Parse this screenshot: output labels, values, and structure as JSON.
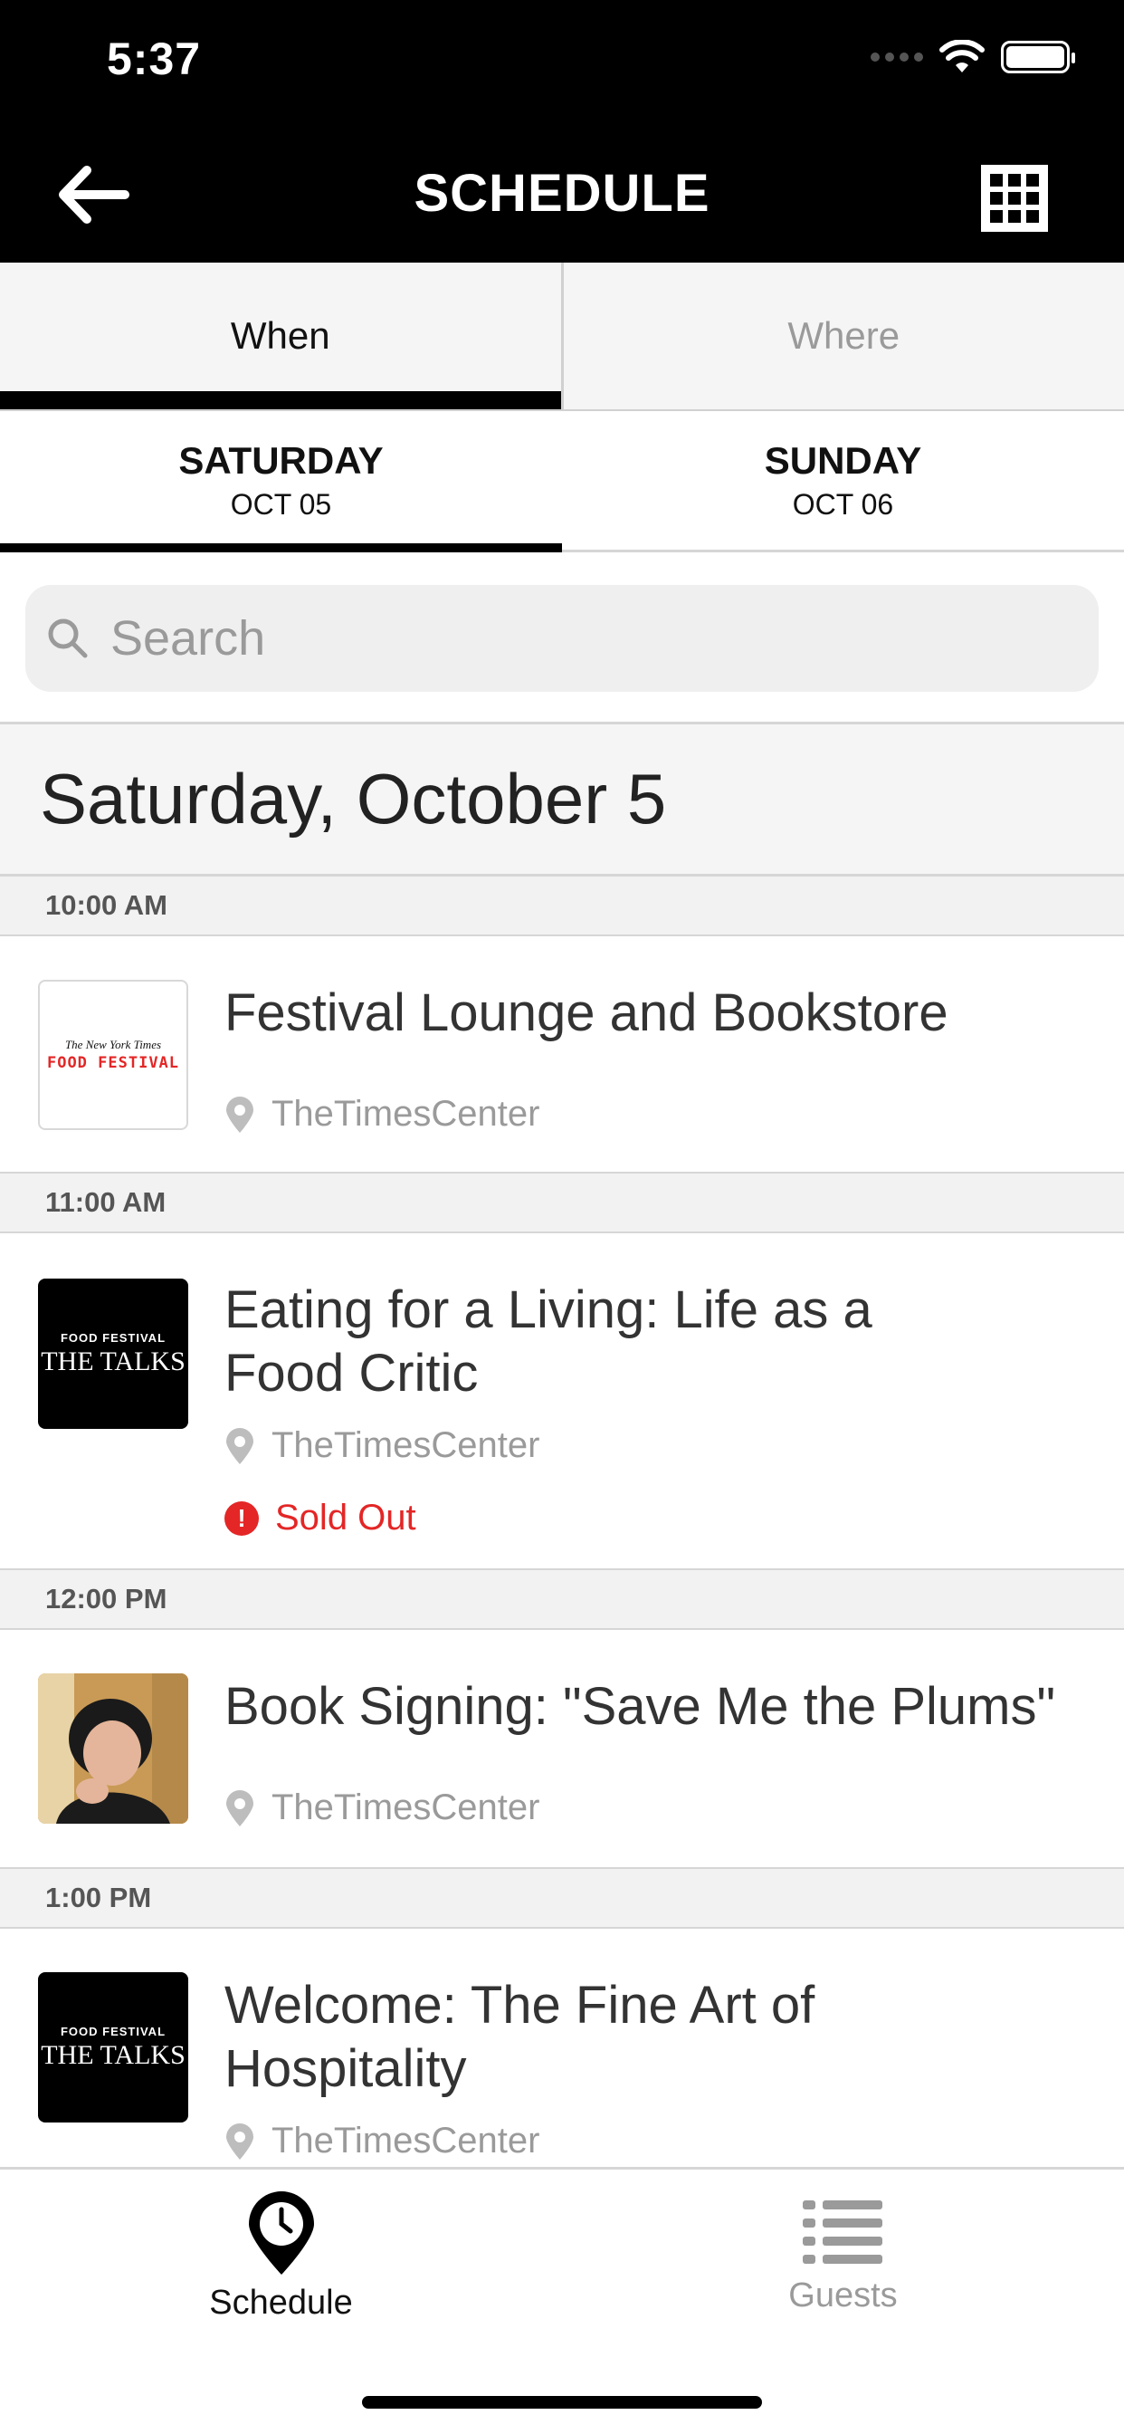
{
  "status_bar": {
    "time": "5:37"
  },
  "header": {
    "title": "SCHEDULE",
    "back_icon": "arrow-left-icon",
    "grid_icon": "grid-icon"
  },
  "segments": [
    {
      "label": "When",
      "active": true
    },
    {
      "label": "Where",
      "active": false
    }
  ],
  "days": [
    {
      "name": "SATURDAY",
      "date": "OCT 05",
      "active": true
    },
    {
      "name": "SUNDAY",
      "date": "OCT 06",
      "active": false
    }
  ],
  "search": {
    "placeholder": "Search"
  },
  "schedule": {
    "date_heading": "Saturday, October 5",
    "slots": [
      {
        "time": "10:00 AM",
        "title": "Festival Lounge and Bookstore",
        "location": "TheTimesCenter",
        "thumb": "food-festival-logo"
      },
      {
        "time": "11:00 AM",
        "title": "Eating for a Living: Life as a Food Critic",
        "location": "TheTimesCenter",
        "status": "Sold Out",
        "thumb": "the-talks"
      },
      {
        "time": "12:00 PM",
        "title": "Book Signing: \"Save Me the Plums\"",
        "location": "TheTimesCenter",
        "thumb": "portrait-photo"
      },
      {
        "time": "1:00 PM",
        "title": "Welcome: The Fine Art of Hospitality",
        "location": "TheTimesCenter",
        "thumb": "the-talks"
      }
    ],
    "logo_text": {
      "masthead": "The New York Times",
      "festival": "FOOD FESTIVAL",
      "talks_top": "FOOD FESTIVAL",
      "talks_main": "THE TALKS"
    }
  },
  "tabbar": [
    {
      "label": "Schedule",
      "icon": "clock-pin-icon",
      "active": true
    },
    {
      "label": "Guests",
      "icon": "list-icon",
      "active": false
    }
  ],
  "colors": {
    "header_bg": "#000000",
    "sold_out": "#e42626",
    "muted": "#9a9a9a"
  }
}
